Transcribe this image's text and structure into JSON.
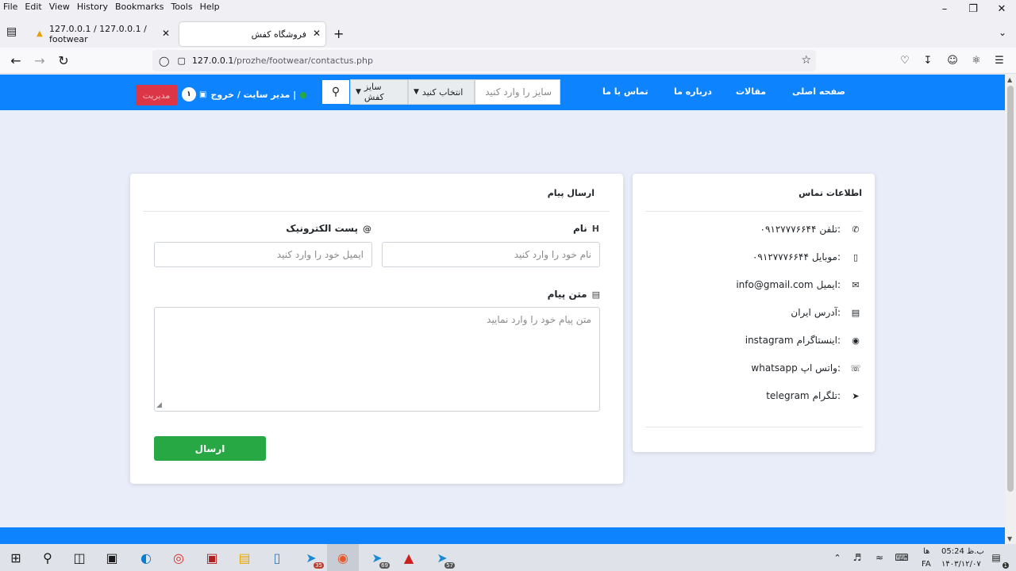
{
  "menu": [
    "File",
    "Edit",
    "View",
    "History",
    "Bookmarks",
    "Tools",
    "Help"
  ],
  "tabs": [
    {
      "title": "127.0.0.1 / 127.0.0.1 / footwear"
    },
    {
      "title": "فروشگاه کفش"
    }
  ],
  "url": {
    "host": "127.0.0.1",
    "path": "/prozhe/footwear/contactus.php"
  },
  "site_nav": {
    "links": [
      "صفحه اصلی",
      "مقالات",
      "درباره ما",
      "تماس با ما"
    ],
    "search_placeholder": "سایز را وارد کنید",
    "select_choose": "انتخاب کنید",
    "select_size": "سایز کفش",
    "admin_button": "مدیریت",
    "user_text": "مدیر سایت / خروج |",
    "cart_count": "۱"
  },
  "contact_info": {
    "title": "اطلاعات تماس",
    "rows": [
      {
        "label": "تلفن:",
        "value": "۰۹۱۲۷۷۷۶۶۴۴",
        "icon": "phone-icon"
      },
      {
        "label": "موبایل:",
        "value": "۰۹۱۲۷۷۷۶۶۴۴",
        "icon": "mobile-icon"
      },
      {
        "label": "ایمیل:",
        "value": "info@gmail.com",
        "icon": "envelope-icon"
      },
      {
        "label": "آدرس:",
        "value": "ایران",
        "icon": "address-card-icon"
      },
      {
        "label": "اینستاگرام:",
        "value": "instagram",
        "icon": "instagram-icon"
      },
      {
        "label": "واتس اپ:",
        "value": "whatsapp",
        "icon": "whatsapp-icon"
      },
      {
        "label": "تلگرام:",
        "value": "telegram",
        "icon": "telegram-icon"
      }
    ]
  },
  "form": {
    "title": "ارسال پیام",
    "name_label": "نام",
    "name_placeholder": "نام خود را وارد کنید",
    "email_label": "پست الکترونیک",
    "email_placeholder": "ایمیل خود را وارد کنید",
    "message_label": "متن پیام",
    "message_placeholder": "متن پیام خود را وارد نمایید",
    "submit_label": "ارسال"
  },
  "taskbar": {
    "time": "05:24 ب.ظ",
    "date": "۱۴۰۳/۱۲/۰۷",
    "lang_top": "ها",
    "lang": "FA",
    "badges": {
      "telegram1": "35",
      "telegram2": "69",
      "telegram3": "57"
    },
    "notification_count": "1"
  }
}
